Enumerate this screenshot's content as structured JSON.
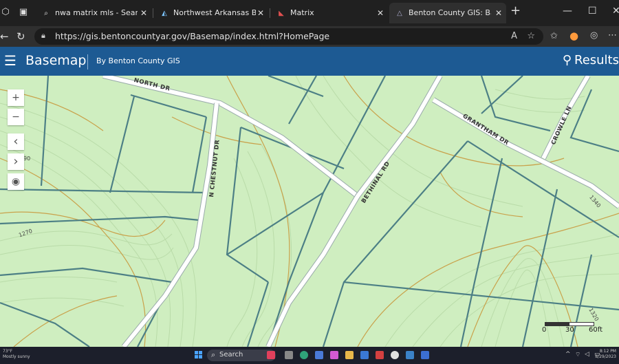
{
  "browser": {
    "tabs": [
      {
        "label": "nwa matrix mls - Search",
        "icon": "search-icon"
      },
      {
        "label": "Northwest Arkansas Board",
        "icon": "nwa-board-icon"
      },
      {
        "label": "Matrix",
        "icon": "matrix-icon"
      },
      {
        "label": "Benton County GIS: Basem",
        "icon": "gis-icon",
        "active": true
      }
    ],
    "new_tab": "+",
    "url": "https://gis.bentoncountyar.gov/Basemap/index.html?HomePage"
  },
  "app": {
    "title": "Basemap",
    "subtitle": "By Benton County GIS",
    "results_label": "Results"
  },
  "map": {
    "zoom_in": "+",
    "zoom_out": "−",
    "prev": "‹",
    "next": "›",
    "road_labels": {
      "north_dr": "NORTH DR",
      "chestnut": "N CHESTNUT DR",
      "bethinal": "BETHINAL RD",
      "grantham": "GRANTHAM DR",
      "crowle": "CROWLE LN"
    },
    "elevations": {
      "e1": "1270",
      "e2": "1340",
      "e3": "1320",
      "e4": "90"
    },
    "scale": {
      "t0": "0",
      "t1": "30",
      "t2": "60ft"
    },
    "colors": {
      "land": "#cfeec0",
      "parcel": "#4c7f85",
      "contour": "#c9a14a",
      "road": "#ffffff",
      "header": "#1d5a93"
    }
  },
  "taskbar": {
    "weather_temp": "73°F",
    "weather_desc": "Mostly sunny",
    "search_label": "Search",
    "time": "8:12 PM",
    "date": "8/29/2023"
  }
}
